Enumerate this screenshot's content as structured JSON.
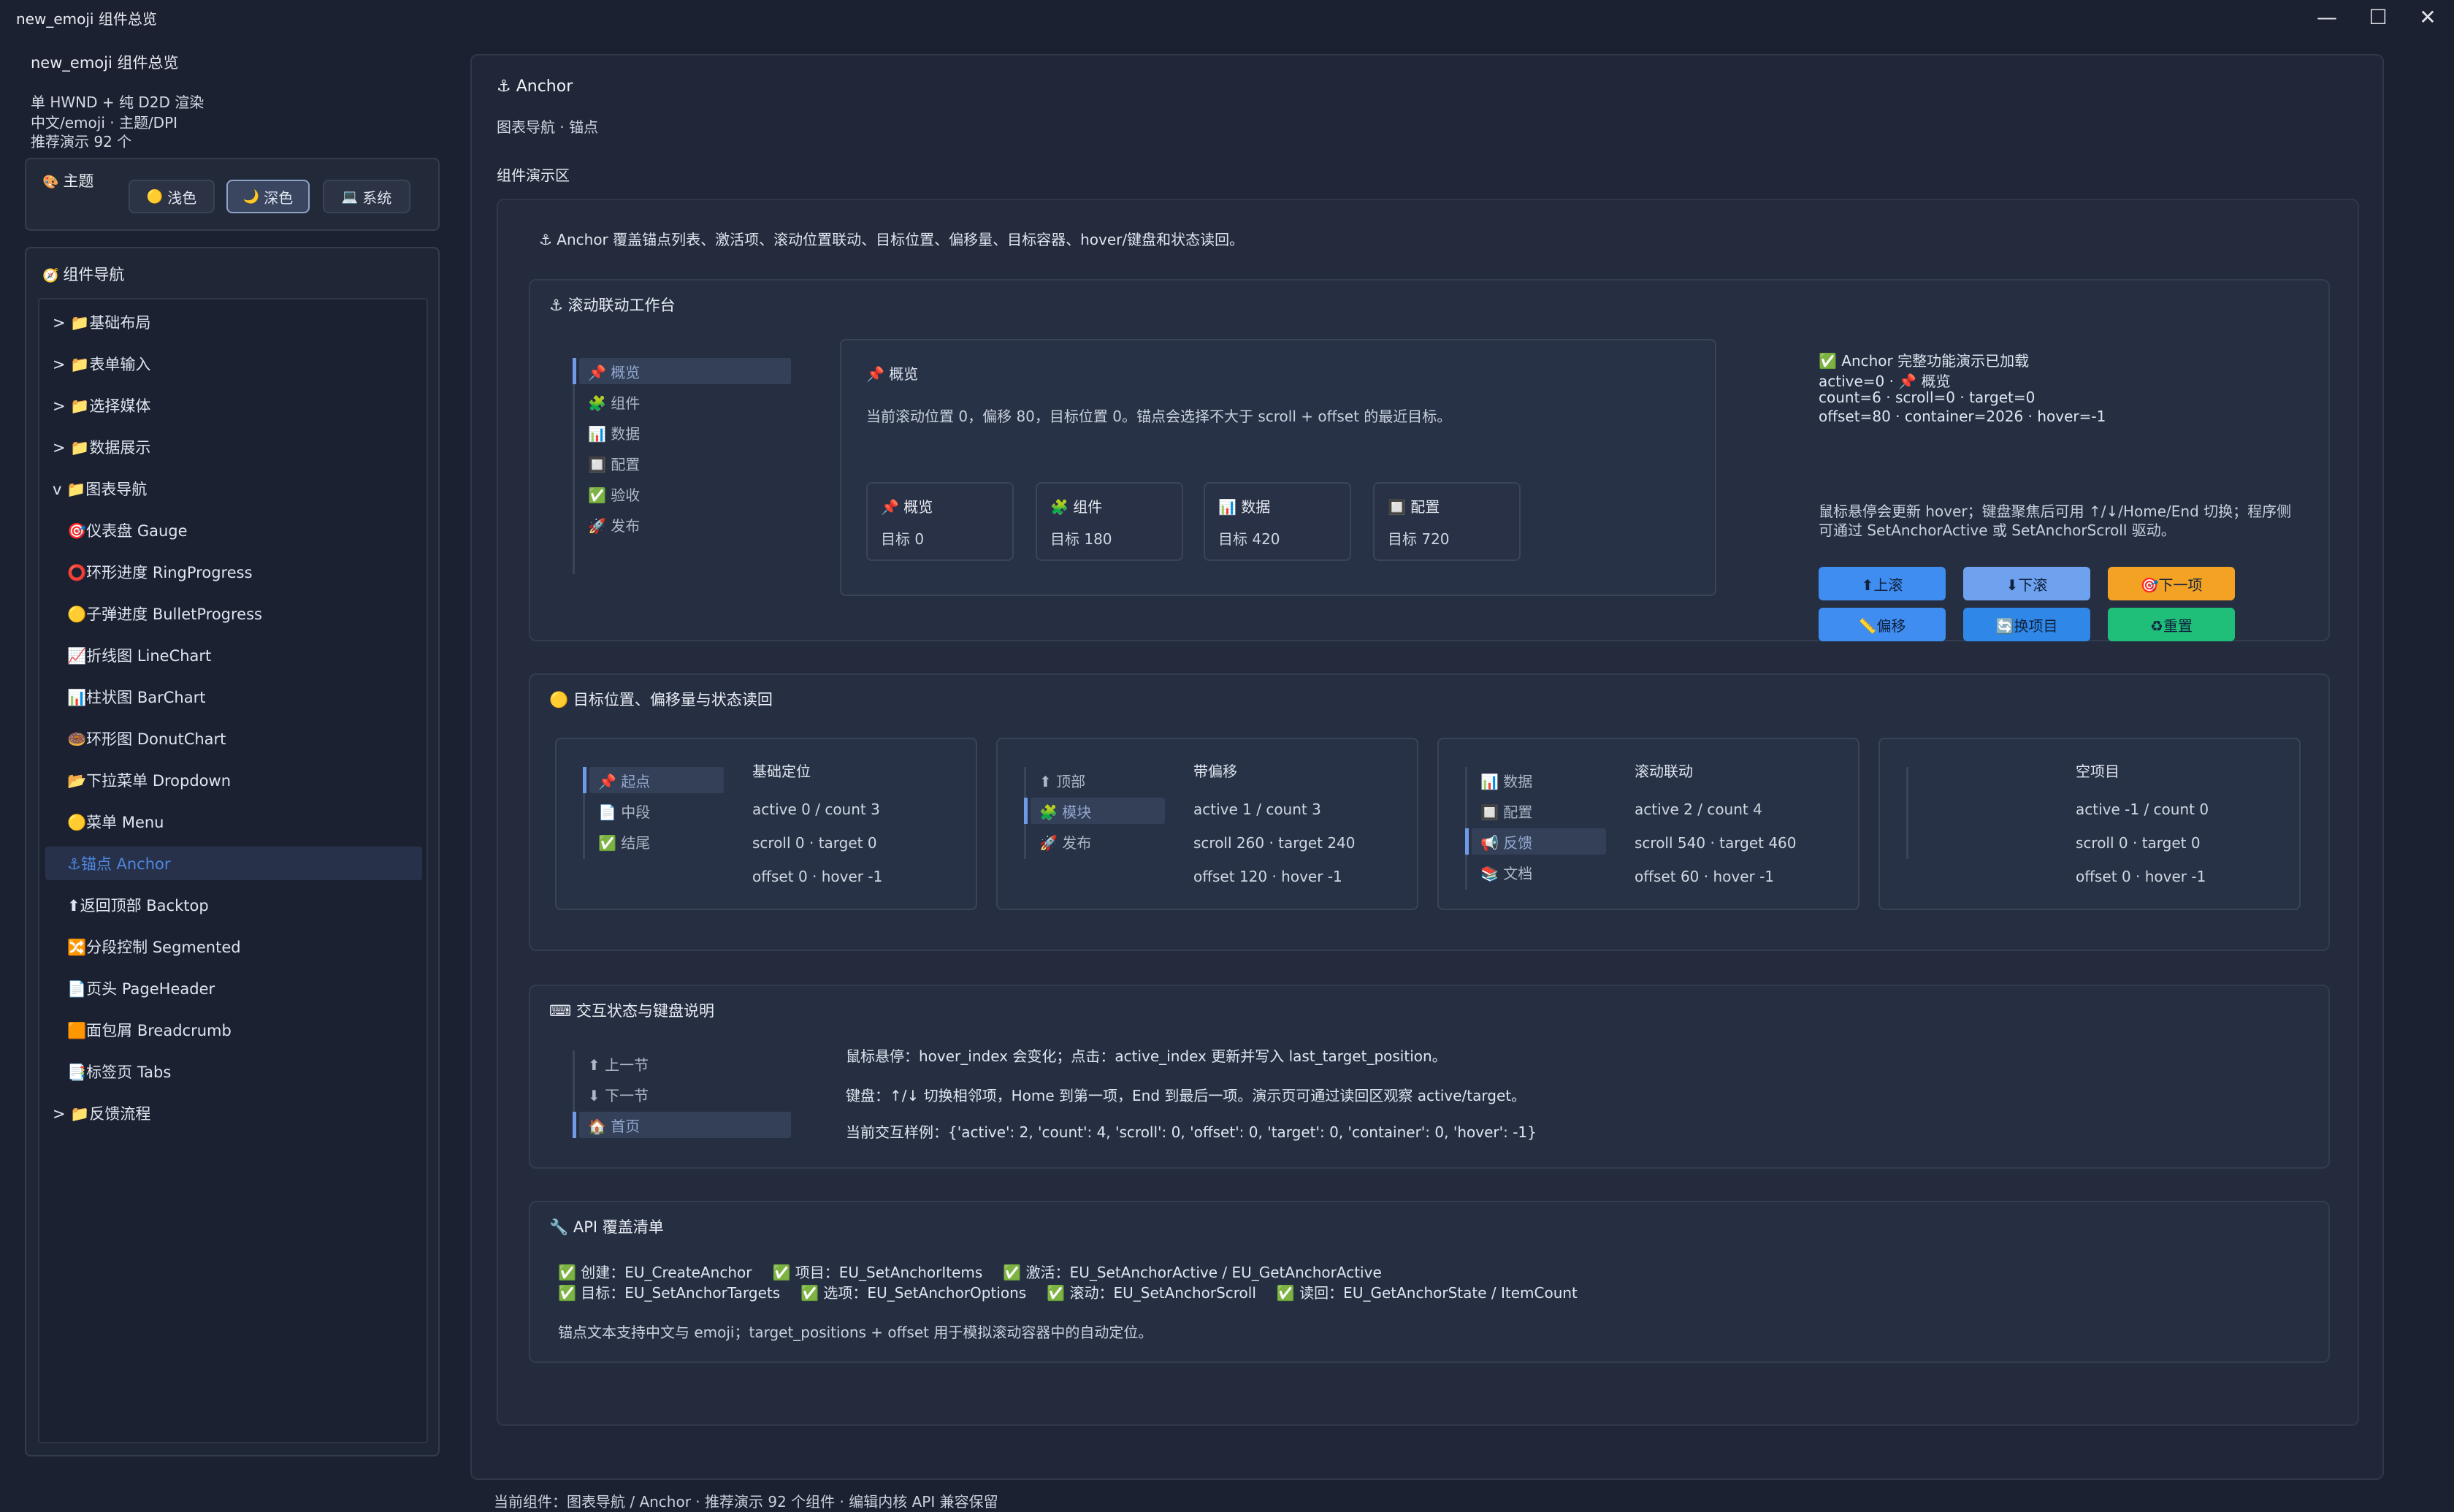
{
  "window": {
    "title": "new_emoji 组件总览",
    "icon": "puzzle-icon"
  },
  "sidebar": {
    "title": "new_emoji 组件总览",
    "info": [
      "单 HWND + 纯 D2D 渲染",
      "中文/emoji · 主题/DPI",
      "推荐演示 92 个"
    ],
    "theme": {
      "label": "主题",
      "buttons": [
        "浅色",
        "深色",
        "系统"
      ],
      "active": "深色"
    },
    "nav_label": "组件导航",
    "items": [
      {
        "label": "> 📁基础布局",
        "sub": false
      },
      {
        "label": "> 📁表单输入",
        "sub": false
      },
      {
        "label": "> 📁选择媒体",
        "sub": false
      },
      {
        "label": "> 📁数据展示",
        "sub": false
      },
      {
        "label": "v 📁图表导航",
        "sub": false
      },
      {
        "label": "🎯仪表盘 Gauge",
        "sub": true
      },
      {
        "label": "⭕环形进度 RingProgress",
        "sub": true
      },
      {
        "label": "🟡子弹进度 BulletProgress",
        "sub": true
      },
      {
        "label": "📈折线图 LineChart",
        "sub": true
      },
      {
        "label": "📊柱状图 BarChart",
        "sub": true
      },
      {
        "label": "🍩环形图 DonutChart",
        "sub": true
      },
      {
        "label": "📂下拉菜单 Dropdown",
        "sub": true
      },
      {
        "label": "🟡菜单 Menu",
        "sub": true
      },
      {
        "label": "⚓锚点 Anchor",
        "sub": true,
        "selected": true
      },
      {
        "label": "⬆返回顶部 Backtop",
        "sub": true
      },
      {
        "label": "🔀分段控制 Segmented",
        "sub": true
      },
      {
        "label": "📄页头 PageHeader",
        "sub": true
      },
      {
        "label": "🟧面包屑 Breadcrumb",
        "sub": true
      },
      {
        "label": "📑标签页 Tabs",
        "sub": true
      },
      {
        "label": "> 📁反馈流程",
        "sub": false
      }
    ]
  },
  "main": {
    "title": "⚓ Anchor",
    "subtitle": "图表导航 · 锚点",
    "demo_label": "组件演示区",
    "intro": "⚓ Anchor 覆盖锚点列表、激活项、滚动位置联动、目标位置、偏移量、目标容器、hover/键盘和状态读回。",
    "workbench": {
      "title": "⚓ 滚动联动工作台",
      "anchors": [
        "📌 概览",
        "🧩 组件",
        "📊 数据",
        "🔲 配置",
        "✅ 验收",
        "🚀 发布"
      ],
      "detail_title": "📌 概览",
      "detail_text": "当前滚动位置 0，偏移 80，目标位置 0。锚点会选择不大于 scroll + offset 的最近目标。",
      "cards": [
        {
          "title": "📌 概览",
          "value": "目标 0"
        },
        {
          "title": "🧩 组件",
          "value": "目标 180"
        },
        {
          "title": "📊 数据",
          "value": "目标 420"
        },
        {
          "title": "🔲 配置",
          "value": "目标 720"
        }
      ],
      "status": [
        "✅ Anchor 完整功能演示已加载",
        "active=0 · 📌 概览",
        "count=6 · scroll=0 · target=0",
        "offset=80 · container=2026 · hover=-1"
      ],
      "help": [
        "鼠标悬停会更新 hover；键盘聚焦后可用 ↑/↓/Home/End 切换；程序侧",
        "可通过 SetAnchorActive 或 SetAnchorScroll 驱动。"
      ],
      "buttons": [
        "⬆上滚",
        "⬇下滚",
        "🎯下一项",
        "📏偏移",
        "🔄换项目",
        "♻重置"
      ],
      "button_colors": [
        "#3f8df0",
        "#6ea2ee",
        "#f3a224",
        "#3f8df0",
        "#2f88e8",
        "#1fbf7a"
      ]
    },
    "offsets": {
      "title": "🟡 目标位置、偏移量与状态读回",
      "groups": [
        {
          "items": [
            "📌 起点",
            "📄 中段",
            "✅ 结尾"
          ],
          "sel": 0,
          "name": "基础定位",
          "lines": [
            "active 0 / count 3",
            "scroll 0 · target 0",
            "offset 0 · hover -1"
          ]
        },
        {
          "items": [
            "⬆ 顶部",
            "🧩 模块",
            "🚀 发布"
          ],
          "sel": 1,
          "name": "带偏移",
          "lines": [
            "active 1 / count 3",
            "scroll 260 · target 240",
            "offset 120 · hover -1"
          ]
        },
        {
          "items": [
            "📊 数据",
            "🔲 配置",
            "📢 反馈",
            "📚 文档"
          ],
          "sel": 2,
          "name": "滚动联动",
          "lines": [
            "active 2 / count 4",
            "scroll 540 · target 460",
            "offset 60 · hover -1"
          ]
        },
        {
          "items": [],
          "sel": -1,
          "name": "空项目",
          "lines": [
            "active -1 / count 0",
            "scroll 0 · target 0",
            "offset 0 · hover -1"
          ]
        }
      ]
    },
    "interaction": {
      "title": "⌨ 交互状态与键盘说明",
      "items": [
        "⬆ 上一节",
        "⬇ 下一节",
        "🏠 首页"
      ],
      "sel": 2,
      "lines": [
        "鼠标悬停：hover_index 会变化；点击：active_index 更新并写入 last_target_position。",
        "键盘：↑/↓ 切换相邻项，Home 到第一项，End 到最后一项。演示页可通过读回区观察 active/target。",
        "当前交互样例：{'active': 2, 'count': 4, 'scroll': 0, 'offset': 0, 'target': 0, 'container': 0, 'hover': -1}"
      ]
    },
    "api": {
      "title": "🔧 API 覆盖清单",
      "row1": [
        "✅ 创建：EU_CreateAnchor",
        "✅ 项目：EU_SetAnchorItems",
        "✅ 激活：EU_SetAnchorActive / EU_GetAnchorActive"
      ],
      "row2": [
        "✅ 目标：EU_SetAnchorTargets",
        "✅ 选项：EU_SetAnchorOptions",
        "✅ 滚动：EU_SetAnchorScroll",
        "✅ 读回：EU_GetAnchorState / ItemCount"
      ],
      "note": "锚点文本支持中文与 emoji；target_positions + offset 用于模拟滚动容器中的自动定位。"
    }
  },
  "statusbar": "当前组件：图表导航 / Anchor · 推荐演示 92 个组件 · 编辑内核 API 兼容保留"
}
